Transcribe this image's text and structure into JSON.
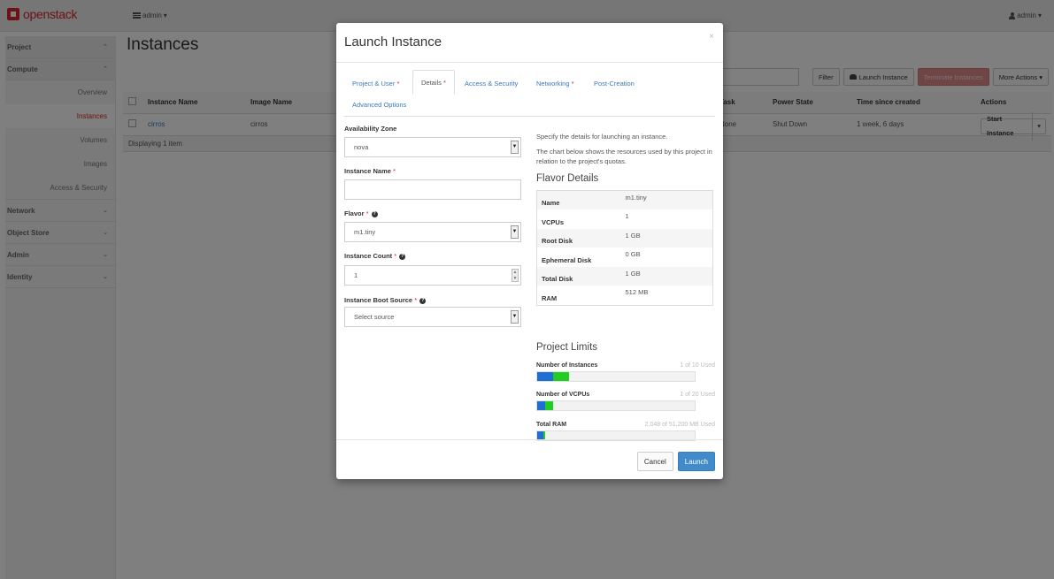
{
  "navbar": {
    "brand": "openstack",
    "project_switcher": "admin",
    "user_menu": "admin"
  },
  "sidebar": {
    "sections": [
      {
        "label": "Project",
        "expanded": true
      },
      {
        "label": "Compute",
        "expanded": true
      },
      {
        "label": "Network",
        "expanded": false
      },
      {
        "label": "Object Store",
        "expanded": false
      },
      {
        "label": "Admin",
        "expanded": false
      },
      {
        "label": "Identity",
        "expanded": false
      }
    ],
    "compute_items": [
      "Overview",
      "Instances",
      "Volumes",
      "Images",
      "Access & Security"
    ],
    "active_item": "Instances"
  },
  "page": {
    "title": "Instances",
    "toolbar": {
      "filter": "Filter",
      "launch": "Launch Instance",
      "terminate": "Terminate Instances",
      "more": "More Actions"
    },
    "table": {
      "headers": [
        "Instance Name",
        "Image Name",
        "Task",
        "Power State",
        "Time since created",
        "Actions"
      ],
      "rows": [
        {
          "name": "cirros",
          "image": "cirros",
          "task": "None",
          "power": "Shut Down",
          "created": "1 week, 6 days",
          "action": "Start Instance"
        }
      ],
      "footer": "Displaying 1 item"
    }
  },
  "modal": {
    "title": "Launch Instance",
    "close": "×",
    "tabs": [
      {
        "label": "Project & User",
        "required": true
      },
      {
        "label": "Details",
        "required": true,
        "active": true
      },
      {
        "label": "Access & Security"
      },
      {
        "label": "Networking",
        "required": true
      },
      {
        "label": "Post-Creation"
      },
      {
        "label": "Advanced Options"
      }
    ],
    "form": {
      "availability_zone_label": "Availability Zone",
      "availability_zone_value": "nova",
      "instance_name_label": "Instance Name",
      "instance_name_value": "",
      "flavor_label": "Flavor",
      "flavor_value": "m1.tiny",
      "count_label": "Instance Count",
      "count_value": "1",
      "boot_source_label": "Instance Boot Source",
      "boot_source_value": "Select source"
    },
    "info": {
      "desc1": "Specify the details for launching an instance.",
      "desc2": "The chart below shows the resources used by this project in relation to the project's quotas.",
      "flavor_title": "Flavor Details",
      "flavor_details": [
        {
          "key": "Name",
          "value": "m1.tiny"
        },
        {
          "key": "VCPUs",
          "value": "1"
        },
        {
          "key": "Root Disk",
          "value": "1 GB"
        },
        {
          "key": "Ephemeral Disk",
          "value": "0 GB"
        },
        {
          "key": "Total Disk",
          "value": "1 GB"
        },
        {
          "key": "RAM",
          "value": "512 MB"
        }
      ],
      "limits_title": "Project Limits",
      "limits": [
        {
          "name": "Number of Instances",
          "used_text": "1 of 10 Used",
          "used_fraction": 0.1,
          "added_fraction": 0.1
        },
        {
          "name": "Number of VCPUs",
          "used_text": "1 of 20 Used",
          "used_fraction": 0.05,
          "added_fraction": 0.05
        },
        {
          "name": "Total RAM",
          "used_text": "2,048 of 51,200 MB Used",
          "used_fraction": 0.04,
          "added_fraction": 0.01
        }
      ],
      "colors": {
        "used": "#1e6ed6",
        "added": "#22cc22"
      }
    },
    "buttons": {
      "cancel": "Cancel",
      "launch": "Launch"
    }
  }
}
